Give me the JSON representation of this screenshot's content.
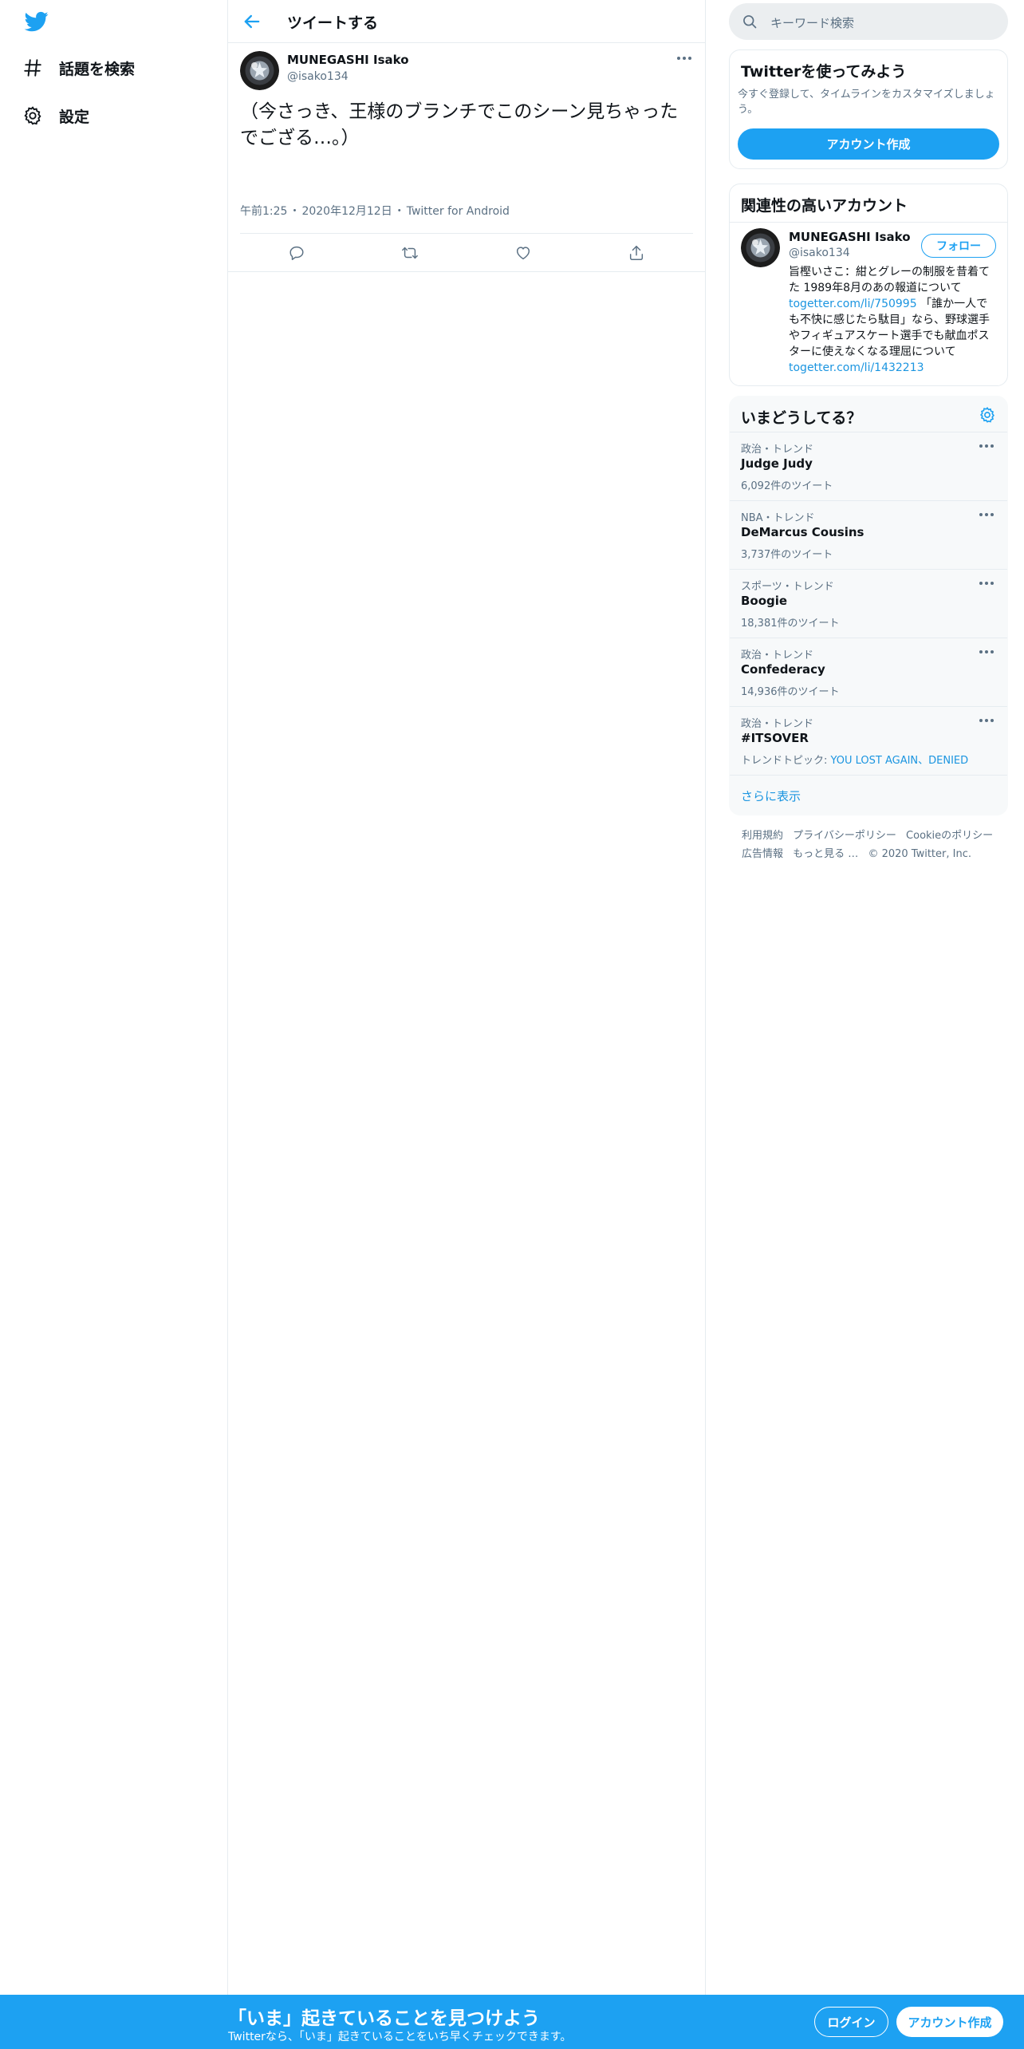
{
  "nav": {
    "logo_icon": "twitter-bird-icon",
    "items": [
      {
        "label": "話題を検索",
        "icon": "hashtag-icon"
      },
      {
        "label": "設定",
        "icon": "gear-icon"
      }
    ]
  },
  "header": {
    "title": "ツイートする",
    "back_icon": "back-arrow-icon"
  },
  "tweet": {
    "author_name": "MUNEGASHI Isako",
    "author_handle": "@isako134",
    "text": "（今さっき、王様のブランチでこのシーン見ちゃったでござる…。）",
    "time": "午前1:25",
    "date": "2020年12月12日",
    "source": "Twitter for Android",
    "separator": "・",
    "actions": [
      "reply-icon",
      "retweet-icon",
      "like-icon",
      "share-icon"
    ]
  },
  "search": {
    "placeholder": "キーワード検索"
  },
  "signup_card": {
    "title": "Twitterを使ってみよう",
    "description": "今すぐ登録して、タイムラインをカスタマイズしましょう。",
    "button": "アカウント作成"
  },
  "related": {
    "title": "関連性の高いアカウント",
    "name": "MUNEGASHI Isako",
    "handle": "@isako134",
    "follow": "フォロー",
    "bio_1": "旨樫いさこ：紺とグレーの制服を昔着てた 1989年8月のあの報道について ",
    "bio_link_1": "togetter.com/li/750995",
    "bio_2": " 「誰か一人でも不快に感じたら駄目」なら、野球選手やフィギュアスケート選手でも献血ポスターに使えなくなる理屈について ",
    "bio_link_2": "togetter.com/li/1432213"
  },
  "trends": {
    "title": "いまどうしてる？",
    "items": [
      {
        "category": "政治・トレンド",
        "name": "Judge Judy",
        "count": "6,092件のツイート"
      },
      {
        "category": "NBA・トレンド",
        "name": "DeMarcus Cousins",
        "count": "3,737件のツイート"
      },
      {
        "category": "スポーツ・トレンド",
        "name": "Boogie",
        "count": "18,381件のツイート"
      },
      {
        "category": "政治・トレンド",
        "name": "Confederacy",
        "count": "14,936件のツイート"
      },
      {
        "category": "政治・トレンド",
        "name": "#ITSOVER",
        "topics_label": "トレンドトピック: ",
        "topics": "YOU LOST AGAIN、DENIED"
      }
    ],
    "show_more": "さらに表示"
  },
  "footer": {
    "links": [
      "利用規約",
      "プライバシーポリシー",
      "Cookieのポリシー",
      "広告情報",
      "もっと見る …"
    ],
    "copyright": "© 2020 Twitter, Inc."
  },
  "bottom_bar": {
    "title": "「いま」起きていることを見つけよう",
    "subtitle": "Twitterなら、「いま」起きていることをいち早くチェックできます。",
    "login": "ログイン",
    "signup": "アカウント作成"
  },
  "colors": {
    "accent": "#1da1f2",
    "link": "#1b95e0",
    "muted": "#5b7083",
    "border": "#e6ecf0"
  }
}
